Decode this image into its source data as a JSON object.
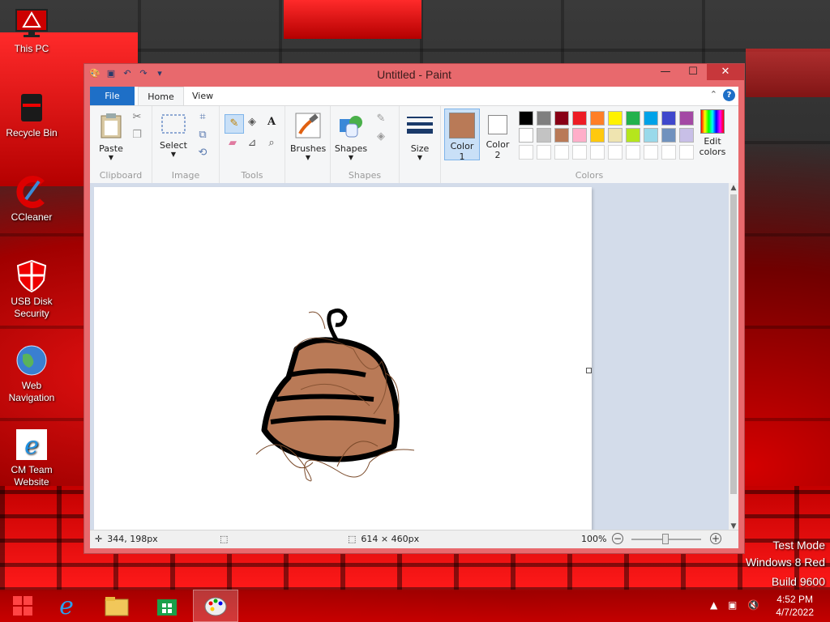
{
  "desktop": {
    "icons": [
      {
        "label": "This PC"
      },
      {
        "label": "Recycle Bin"
      },
      {
        "label": "CCleaner"
      },
      {
        "label": "USB Disk Security"
      },
      {
        "label": "Web Navigation"
      },
      {
        "label": "CM Team Website"
      }
    ],
    "watermark": {
      "line1": "Test Mode",
      "line2": "Windows 8 Red",
      "line3": "Build 9600"
    }
  },
  "window": {
    "title": "Untitled - Paint",
    "controls": {
      "minimize": "—",
      "maximize": "☐",
      "close": "✕"
    }
  },
  "tabs": {
    "file": "File",
    "home": "Home",
    "view": "View"
  },
  "ribbon": {
    "clipboard": {
      "paste": "Paste",
      "group": "Clipboard"
    },
    "image": {
      "select": "Select",
      "group": "Image"
    },
    "tools": {
      "group": "Tools"
    },
    "brushes": {
      "label": "Brushes"
    },
    "shapes": {
      "label": "Shapes",
      "group": "Shapes"
    },
    "size": {
      "label": "Size"
    },
    "colors": {
      "color1_line1": "Color",
      "color1_line2": "1",
      "color2_line1": "Color",
      "color2_line2": "2",
      "edit_line1": "Edit",
      "edit_line2": "colors",
      "group": "Colors",
      "color1_value": "#b97a57",
      "color2_value": "#ffffff",
      "palette_row1": [
        "#000000",
        "#7f7f7f",
        "#880015",
        "#ed1c24",
        "#ff7f27",
        "#fff200",
        "#22b14c",
        "#00a2e8",
        "#3f48cc",
        "#a349a4"
      ],
      "palette_row2": [
        "#ffffff",
        "#c3c3c3",
        "#b97a57",
        "#ffaec9",
        "#ffc90e",
        "#efe4b0",
        "#b5e61d",
        "#99d9ea",
        "#7092be",
        "#c8bfe7"
      ],
      "palette_row3": [
        "#ffffff",
        "#ffffff",
        "#ffffff",
        "#ffffff",
        "#ffffff",
        "#ffffff",
        "#ffffff",
        "#ffffff",
        "#ffffff",
        "#ffffff"
      ]
    }
  },
  "status": {
    "cursor_pos": "344, 198px",
    "selection_size": "",
    "canvas_size": "614 × 460px",
    "zoom": "100%"
  },
  "taskbar": {
    "time": "4:52 PM",
    "date": "4/7/2022",
    "pinned": [
      "internet-explorer-icon",
      "file-explorer-icon",
      "store-icon",
      "paint-icon"
    ]
  }
}
